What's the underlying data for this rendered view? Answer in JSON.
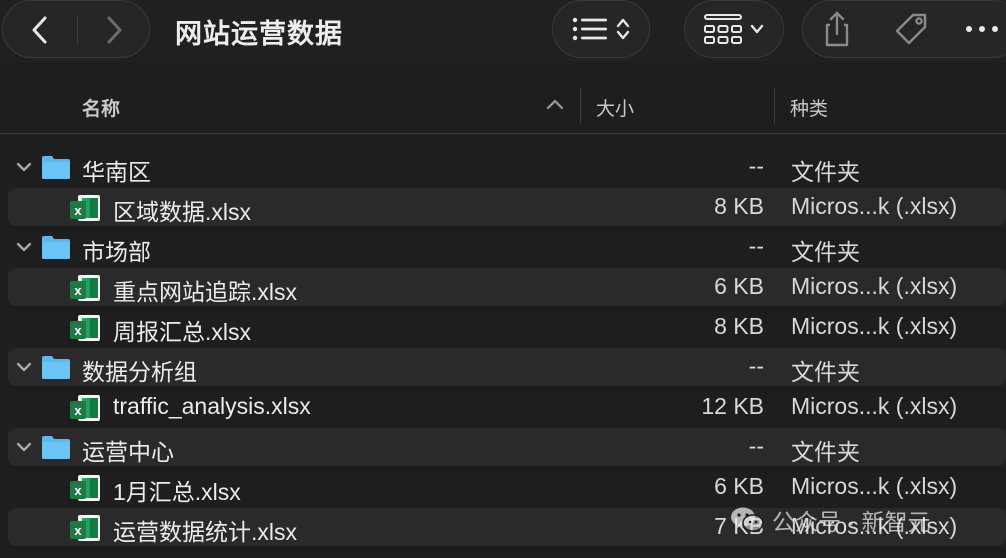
{
  "window": {
    "title": "网站运营数据"
  },
  "toolbar": {
    "back_icon": "chevron-left-icon",
    "forward_icon": "chevron-right-icon",
    "view_mode_icon": "list-view-icon",
    "group_icon": "icon-grid-icon",
    "share_icon": "share-icon",
    "tag_icon": "tag-icon",
    "more_icon": "ellipsis-icon"
  },
  "columns": {
    "name": "名称",
    "size": "大小",
    "kind": "种类",
    "sort_icon": "chevron-up-icon"
  },
  "rows": [
    {
      "type": "folder",
      "name": "华南区",
      "size": "--",
      "kind": "文件夹"
    },
    {
      "type": "file",
      "name": "区域数据.xlsx",
      "size": "8 KB",
      "kind": "Micros...k (.xlsx)"
    },
    {
      "type": "folder",
      "name": "市场部",
      "size": "--",
      "kind": "文件夹"
    },
    {
      "type": "file",
      "name": "重点网站追踪.xlsx",
      "size": "6 KB",
      "kind": "Micros...k (.xlsx)"
    },
    {
      "type": "file",
      "name": "周报汇总.xlsx",
      "size": "8 KB",
      "kind": "Micros...k (.xlsx)"
    },
    {
      "type": "folder",
      "name": "数据分析组",
      "size": "--",
      "kind": "文件夹"
    },
    {
      "type": "file",
      "name": "traffic_analysis.xlsx",
      "size": "12 KB",
      "kind": "Micros...k (.xlsx)"
    },
    {
      "type": "folder",
      "name": "运营中心",
      "size": "--",
      "kind": "文件夹"
    },
    {
      "type": "file",
      "name": "1月汇总.xlsx",
      "size": "6 KB",
      "kind": "Micros...k (.xlsx)"
    },
    {
      "type": "file",
      "name": "运营数据统计.xlsx",
      "size": "7 KB",
      "kind": "Micros...k (.xlsx)"
    }
  ],
  "watermark": {
    "text": "公众号 · 新智元"
  },
  "colors": {
    "background": "#1e1e1e",
    "folder_blue": "#5ab7f0",
    "excel_green": "#1d7a45"
  }
}
